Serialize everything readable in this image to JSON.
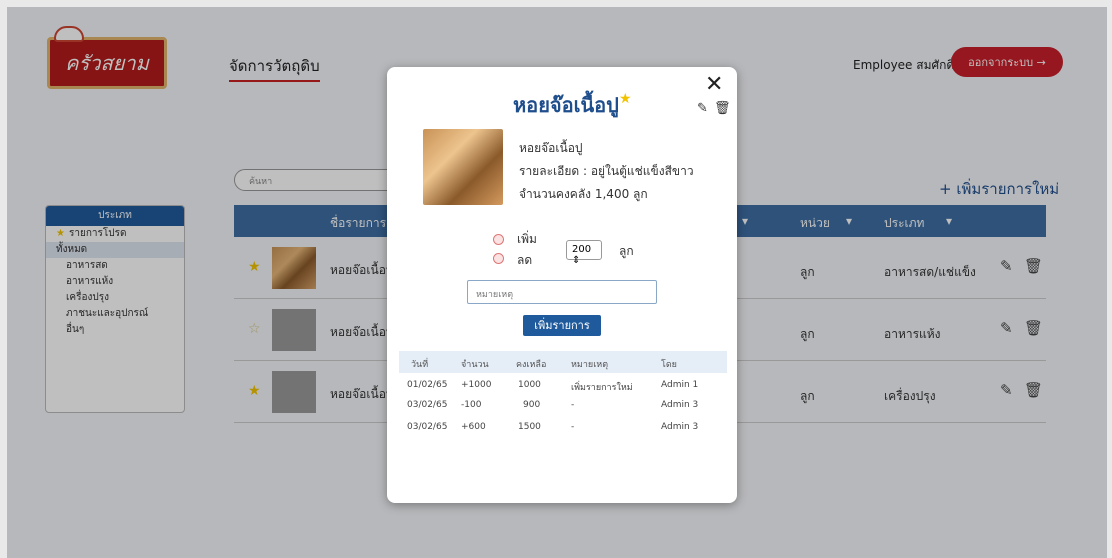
{
  "header": {
    "logo_text": "ครัวสยาม",
    "page_title": "จัดการวัตถุดิบ",
    "employee": "Employee สมศักดิ์",
    "logout_label": "ออกจากระบบ →"
  },
  "search": {
    "placeholder": "ค้นหา"
  },
  "add_new_label": "+ เพิ่มรายการใหม่",
  "categories": {
    "header": "ประเภท",
    "favorites": "รายการโปรด",
    "all": "ทั้งหมด",
    "items": [
      "อาหารสด",
      "อาหารแห้ง",
      "เครื่องปรุง",
      "ภาชนะและอุปกรณ์",
      "อื่นๆ"
    ]
  },
  "table": {
    "headers": {
      "name": "ชื่อรายการ",
      "unit": "หน่วย",
      "type": "ประเภท"
    },
    "rows": [
      {
        "name": "หอยจ๊อเนื้อปู",
        "unit": "ลูก",
        "type": "อาหารสด/แช่แข็ง",
        "favorite": true
      },
      {
        "name": "หอยจ๊อเนื้อปู",
        "unit": "ลูก",
        "type": "อาหารแห้ง",
        "favorite": false
      },
      {
        "name": "หอยจ๊อเนื้อปู",
        "unit": "ลูก",
        "type": "เครื่องปรุง",
        "favorite": true
      }
    ]
  },
  "modal": {
    "title": "หอยจ๊อเนื้อปู",
    "item_name": "หอยจ๊อเนื้อปู",
    "detail": "รายละเอียด : อยู่ในตู้แช่แข็งสีขาว",
    "stock": "จำนวนคงคลัง 1,400 ลูก",
    "increase": "เพิ่ม",
    "decrease": "ลด",
    "quantity": "200",
    "unit": "ลูก",
    "note_placeholder": "หมายเหตุ",
    "add_label": "เพิ่มรายการ",
    "history_headers": [
      "วันที่",
      "จำนวน",
      "คงเหลือ",
      "หมายเหตุ",
      "โดย"
    ],
    "history": [
      [
        "01/02/65",
        "+1000",
        "1000",
        "เพิ่มรายการใหม่",
        "Admin 1"
      ],
      [
        "03/02/65",
        "-100",
        "900",
        "-",
        "Admin 3"
      ],
      [
        "03/02/65",
        "+600",
        "1500",
        "-",
        "Admin 3"
      ]
    ]
  }
}
